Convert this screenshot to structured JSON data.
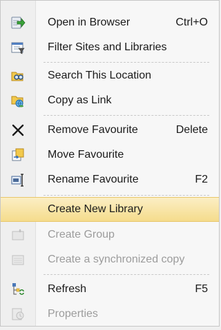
{
  "menu": {
    "items": [
      {
        "label": "Open in Browser",
        "shortcut": "Ctrl+O",
        "icon": "open-in-browser-icon",
        "disabled": false
      },
      {
        "label": "Filter Sites and Libraries",
        "shortcut": "",
        "icon": "filter-sites-icon",
        "disabled": false
      },
      {
        "label": "Search This Location",
        "shortcut": "",
        "icon": "search-location-icon",
        "disabled": false
      },
      {
        "label": "Copy as Link",
        "shortcut": "",
        "icon": "copy-link-icon",
        "disabled": false
      },
      {
        "label": "Remove Favourite",
        "shortcut": "Delete",
        "icon": "remove-x-icon",
        "disabled": false
      },
      {
        "label": "Move Favourite",
        "shortcut": "",
        "icon": "move-favourite-icon",
        "disabled": false
      },
      {
        "label": "Rename Favourite",
        "shortcut": "F2",
        "icon": "rename-icon",
        "disabled": false
      },
      {
        "label": "Create New Library",
        "shortcut": "",
        "icon": "",
        "disabled": false,
        "highlighted": true
      },
      {
        "label": "Create Group",
        "shortcut": "",
        "icon": "create-group-icon",
        "disabled": true
      },
      {
        "label": "Create a synchronized copy",
        "shortcut": "",
        "icon": "sync-copy-icon",
        "disabled": true
      },
      {
        "label": "Refresh",
        "shortcut": "F5",
        "icon": "refresh-icon",
        "disabled": false
      },
      {
        "label": "Properties",
        "shortcut": "",
        "icon": "properties-icon",
        "disabled": true
      }
    ]
  }
}
